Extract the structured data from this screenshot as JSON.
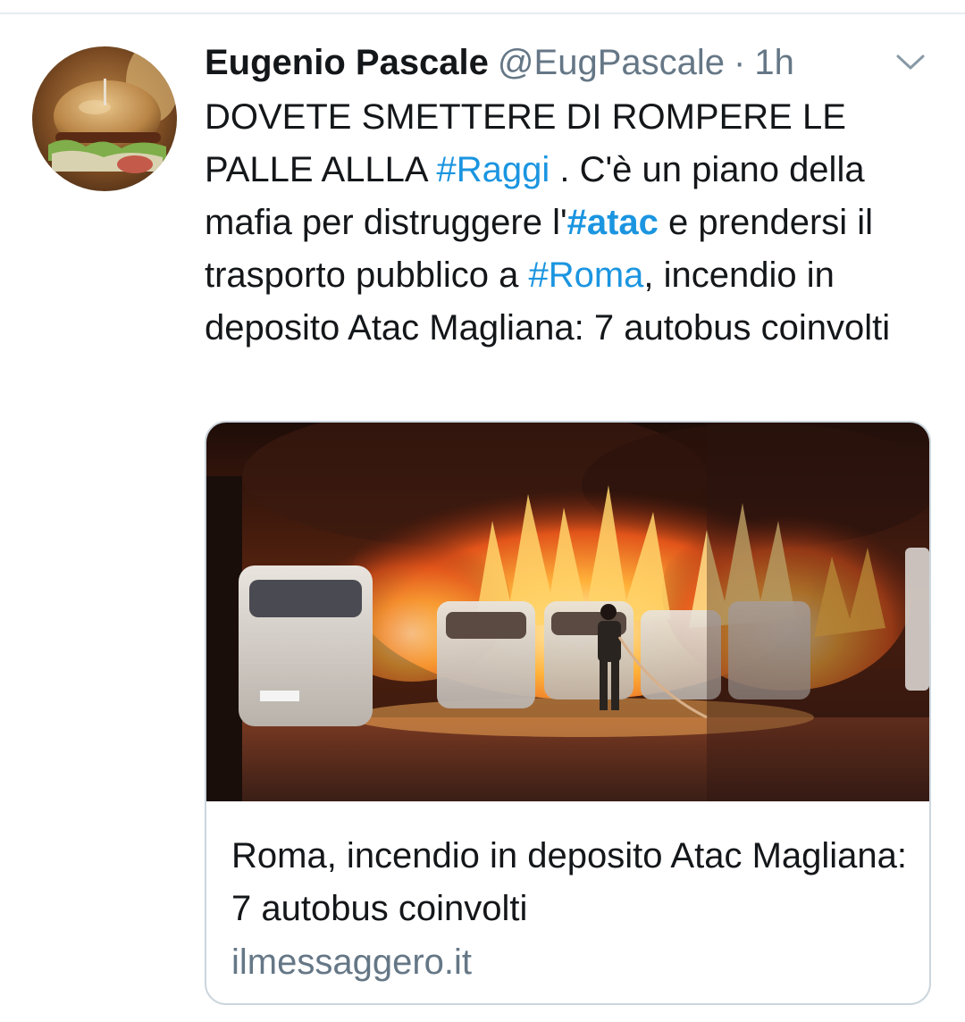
{
  "tweet": {
    "display_name": "Eugenio Pascale",
    "handle": "@EugPascale",
    "separator": "·",
    "time": "1h",
    "menu_icon": "chevron-down-icon",
    "avatar_icon": "burger-photo-avatar",
    "text": {
      "part1": "DOVETE SMETTERE DI ROMPERE LE PALLE ALLLA ",
      "hashtag_raggi": "#Raggi",
      "part2": " . C'è un piano della mafia per distruggere l'",
      "hashtag_atac": "#atac",
      "part3": " e prendersi il trasporto pubblico a ",
      "hashtag_roma": "#Roma",
      "part4": ", incendio in deposito Atac Magliana: 7 autobus coinvolti"
    },
    "link_color": "#1b95e0"
  },
  "card": {
    "image_icon": "bus-depot-fire-photo",
    "title": "Roma, incendio in deposito Atac Magliana: 7 autobus coinvolti",
    "domain": "ilmessaggero.it"
  }
}
